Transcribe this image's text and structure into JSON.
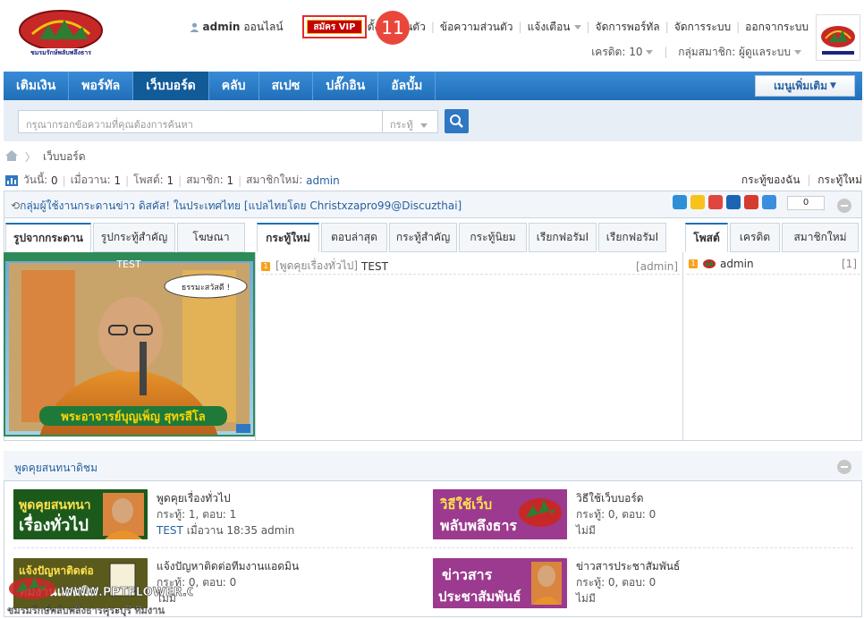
{
  "header": {
    "username": "admin",
    "online_text": "ออนไลน์",
    "vip_label": "สมัคร VIP",
    "notification_count": "11",
    "links": [
      "ตั้งค่าส่วนตัว",
      "ข้อความส่วนตัว",
      "แจ้งเตือน",
      "จัดการพอร์ทัล",
      "จัดการระบบ",
      "ออกจากระบบ"
    ],
    "credit_label": "เครดิต: 10",
    "group_label": "กลุ่มสมาชิก: ผู้ดูแลระบบ"
  },
  "nav": {
    "items": [
      "เติมเงิน",
      "พอร์ทัล",
      "เว็บบอร์ด",
      "คลับ",
      "สเปซ",
      "ปลั๊กอิน",
      "อัลบั้ม"
    ],
    "active_index": 2,
    "more_menu": "เมนูเพิ่มเติม"
  },
  "search": {
    "placeholder": "กรุณากรอกข้อความที่คุณต้องการค้นหา",
    "scope": "กระทู้"
  },
  "breadcrumb": {
    "current": "เว็บบอร์ด"
  },
  "stats": {
    "today_label": "วันนี้:",
    "today": "0",
    "yesterday_label": "เมื่อวาน:",
    "yesterday": "1",
    "posts_label": "โพสต์:",
    "posts": "1",
    "members_label": "สมาชิก:",
    "members": "1",
    "newest_label": "สมาชิกใหม่:",
    "newest": "admin",
    "my_threads": "กระทู้ของฉัน",
    "new_threads": "กระทู้ใหม่"
  },
  "notice": {
    "text": "กลุ่มผู้ใช้งานกระดานข่าว ดิสคัส! ในประเทศไทย [แปลไทยโดย Christxzapro99@Discuzthai]",
    "share_count": "0"
  },
  "left_tabs": [
    "รูปจากกระดาน",
    "รูปกระทู้สำคัญ",
    "โฆษณา"
  ],
  "left_image": {
    "title": "TEST",
    "bubble": "ธรรมะสวัสดี !",
    "caption": "พระอาจารย์บุญเพ็ญ สุทรสีโล"
  },
  "mid_tabs": [
    "กระทู้ใหม่",
    "ตอบล่าสุด",
    "กระทู้สำคัญ",
    "กระทู้นิยม",
    "เรียกฟอรัมI",
    "เรียกฟอรัมI"
  ],
  "mid_rows": [
    {
      "num": "1",
      "forum": "[พูดคุยเรื่องทั่วไป]",
      "title": "TEST",
      "author": "[admin]"
    }
  ],
  "right_tabs": [
    "โพสต์",
    "เครดิต",
    "สมาชิกใหม่"
  ],
  "right_rows": [
    {
      "num": "1",
      "name": "admin",
      "count": "[1]"
    }
  ],
  "forum_section": {
    "title": "พูดคุยสนทนาดิชม",
    "forums": [
      {
        "img_top": "พูดคุยสนทนา",
        "img_bottom": "เรื่องทั่วไป",
        "name": "พูดคุยเรื่องทั่วไป",
        "stats": "กระทู้: 1, ตอบ: 1",
        "last_link": "TEST",
        "last_meta": "เมื่อวาน 18:35 admin",
        "img_color": "#1c5a1c"
      },
      {
        "img_top": "วิธีใช้เว็บ",
        "img_bottom": "พลับพลึงธาร",
        "name": "วิธีใช้เว็บบอร์ด",
        "stats": "กระทู้: 0, ตอบ: 0",
        "last_link": "",
        "last_meta": "ไม่มี",
        "img_color": "#9b3a8e"
      },
      {
        "img_top": "แจ้งปัญหาติดต่อ",
        "img_bottom": "ทีมงานแอดมิน",
        "name": "แจ้งปัญหาติดต่อทีมงานแอดมิน",
        "stats": "กระทู้: 0, ตอบ: 0",
        "last_link": "",
        "last_meta": "ไม่มี",
        "img_color": "#5a5a1c"
      },
      {
        "img_top": "ข่าวสาร",
        "img_bottom": "ประชาสัมพันธ์",
        "name": "ข่าวสารประชาสัมพันธ์",
        "stats": "กระทู้: 0, ตอบ: 0",
        "last_link": "",
        "last_meta": "ไม่มี",
        "img_color": "#9b3a8e"
      }
    ]
  },
  "watermark": {
    "url": "WWW.PPTFLOWER.COM",
    "text": "ชมรมรักษ์พลับพลึงธารคุระบุรี ทีมงาน"
  },
  "colors": {
    "nav": "#1f6fb8",
    "link": "#2860a0",
    "vip": "#c40000",
    "badge": "#e9473c"
  }
}
